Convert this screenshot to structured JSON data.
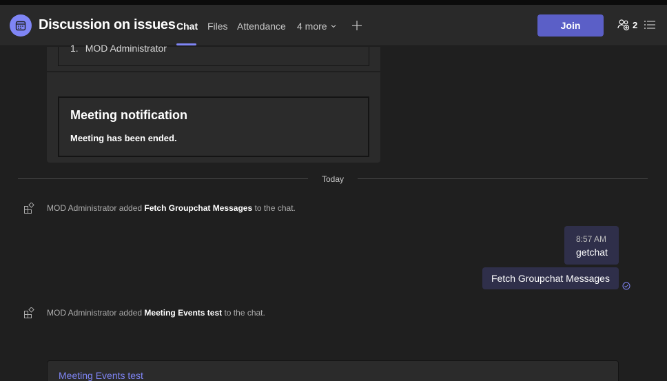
{
  "header": {
    "title": "Discussion on issues",
    "tabs": [
      {
        "label": "Chat",
        "active": true
      },
      {
        "label": "Files",
        "active": false
      },
      {
        "label": "Attendance",
        "active": false
      }
    ],
    "more_label": "4 more",
    "join_label": "Join",
    "participant_count": "2",
    "icons": {
      "meeting": "calendar-icon",
      "add": "plus-icon",
      "participants": "people-add-icon",
      "list": "list-icon"
    }
  },
  "chat": {
    "earlier_card": {
      "partial_user": "MOD Administrator",
      "notification_title": "Meeting notification",
      "notification_body": "Meeting has been ended."
    },
    "day_divider": "Today",
    "system_messages": [
      {
        "actor": "MOD Administrator",
        "verb": "added",
        "target": "Fetch Groupchat Messages",
        "suffix": "to the chat."
      },
      {
        "actor": "MOD Administrator",
        "verb": "added",
        "target": "Meeting Events test",
        "suffix": "to the chat."
      }
    ],
    "my_messages": {
      "time": "8:57 AM",
      "first": "getchat",
      "second": "Fetch Groupchat Messages"
    },
    "bottom_card_link": "Meeting Events test"
  },
  "colors": {
    "accent": "#7f85f5",
    "join": "#5b5fc7",
    "bubble": "#2f2f4a",
    "background": "#1f1f1f",
    "header": "#292929"
  }
}
